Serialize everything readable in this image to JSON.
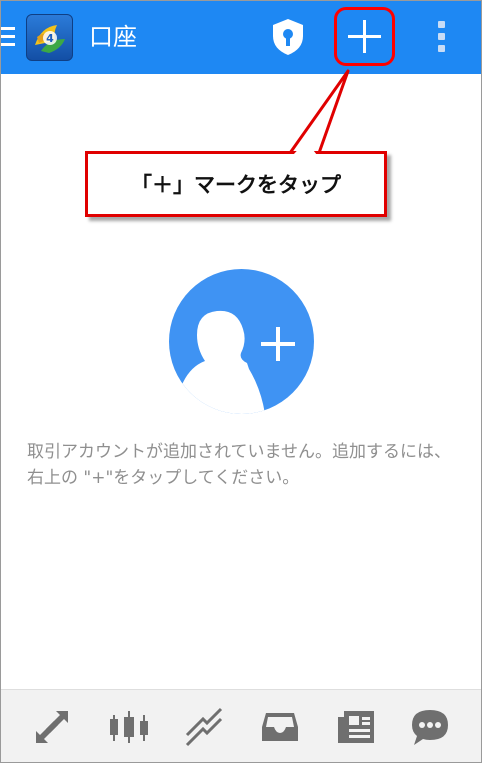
{
  "header": {
    "title": "口座",
    "icons": [
      "menu-icon",
      "metatrader-logo",
      "shield-lock-icon",
      "add-icon",
      "more-vert-icon"
    ]
  },
  "annotation": {
    "callout_text": "「＋」マークをタップ",
    "highlight_color": "#ff0000"
  },
  "empty_state": {
    "message": "取引アカウントが追加されていません。追加するには、右上の \"+\"をタップしてください。",
    "icon": "add-person-icon"
  },
  "bottom_nav": {
    "items": [
      "trade-icon",
      "chart-icon",
      "history-icon",
      "inbox-icon",
      "news-icon",
      "chat-icon"
    ]
  },
  "colors": {
    "accent": "#1e88f3",
    "illustration": "#3f93f3",
    "nav_icon": "#6f6f6f",
    "muted_text": "#8f8f8f"
  }
}
